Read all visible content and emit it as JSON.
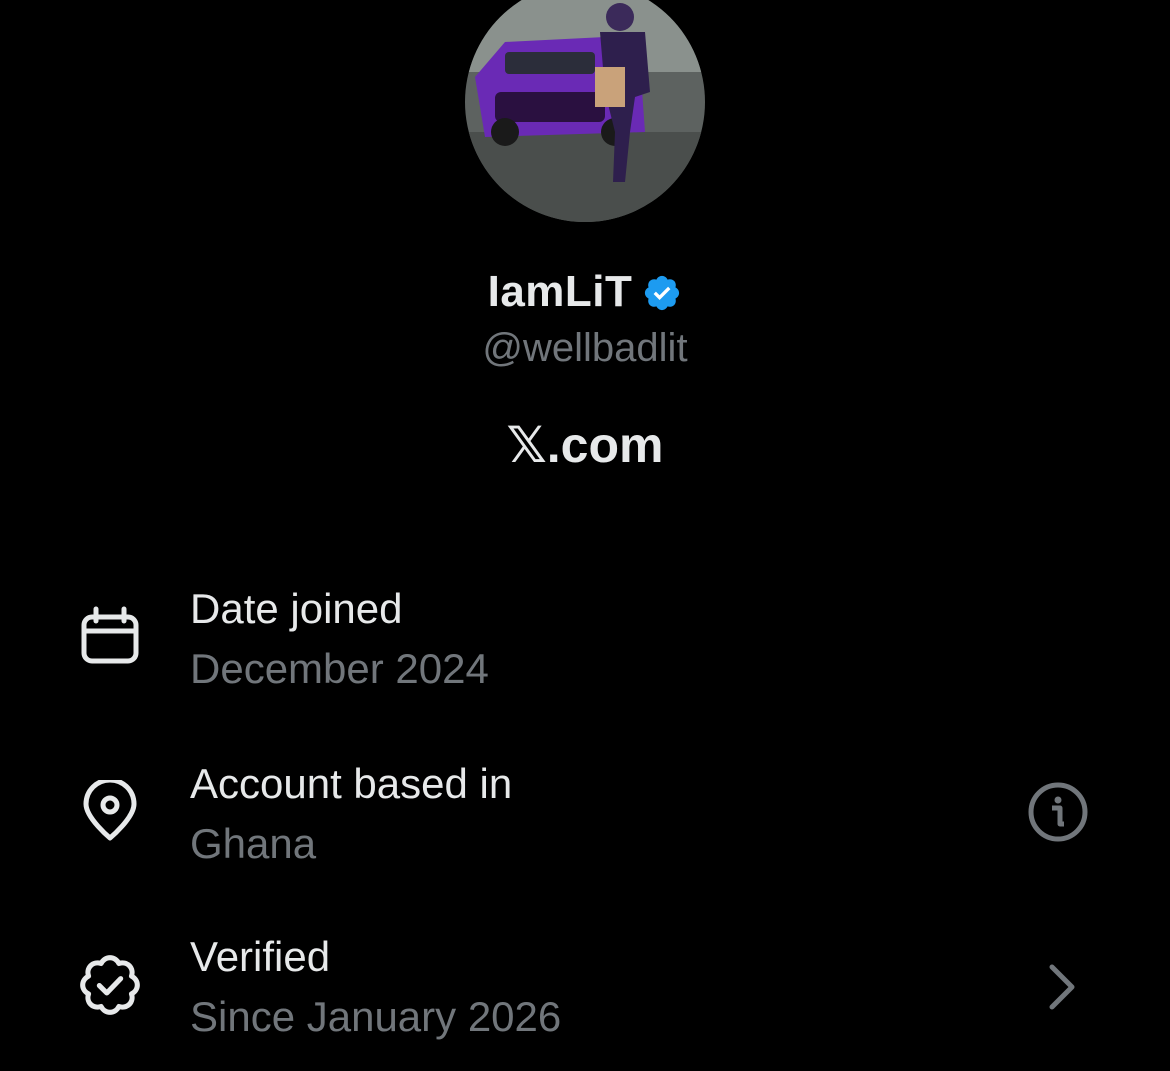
{
  "profile": {
    "display_name": "IamLiT",
    "handle": "@wellbadlit",
    "site": "𝕏.com",
    "avatar_icon": "profile-photo",
    "verified_badge_icon": "verified-badge-icon",
    "badge_color": "#1d9bf0"
  },
  "rows": [
    {
      "icon": "calendar-icon",
      "label": "Date joined",
      "value": "December 2024"
    },
    {
      "icon": "location-pin-icon",
      "label": "Account based in",
      "value": "Ghana",
      "trailing_icon": "info-icon"
    },
    {
      "icon": "verified-outline-icon",
      "label": "Verified",
      "value": "Since January 2026",
      "trailing_icon": "chevron-right-icon"
    }
  ],
  "colors": {
    "background": "#000000",
    "primary_text": "#e7e9ea",
    "secondary_text": "#71767b"
  }
}
